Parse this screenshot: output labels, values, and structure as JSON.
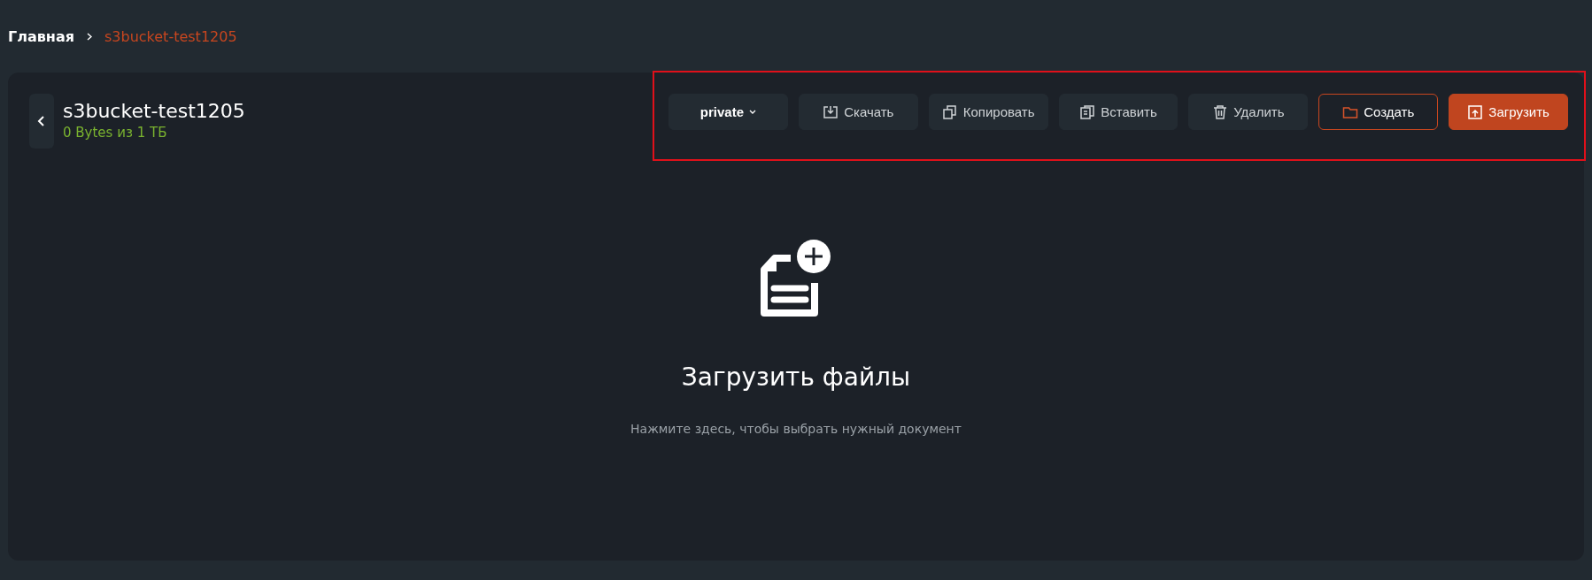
{
  "breadcrumbs": [
    {
      "label": "Главная",
      "selected": false
    },
    {
      "label": "s3bucket-test1205",
      "selected": true
    }
  ],
  "bucket": {
    "title": "s3bucket-test1205",
    "usage": "0 Bytes из 1 ТБ"
  },
  "toolbar": [
    {
      "kind": "dropdown",
      "label": "private"
    },
    {
      "kind": "secondary",
      "label": "Скачать"
    },
    {
      "kind": "secondary",
      "label": "Копировать"
    },
    {
      "kind": "secondary",
      "label": "Вставить"
    },
    {
      "kind": "secondary",
      "label": "Удалить"
    },
    {
      "kind": "outline",
      "label": "Создать"
    },
    {
      "kind": "primary",
      "label": "Загрузить"
    }
  ],
  "upload": {
    "title": "Загрузить файлы",
    "hint": "Нажмите здесь, чтобы выбрать нужный документ"
  }
}
